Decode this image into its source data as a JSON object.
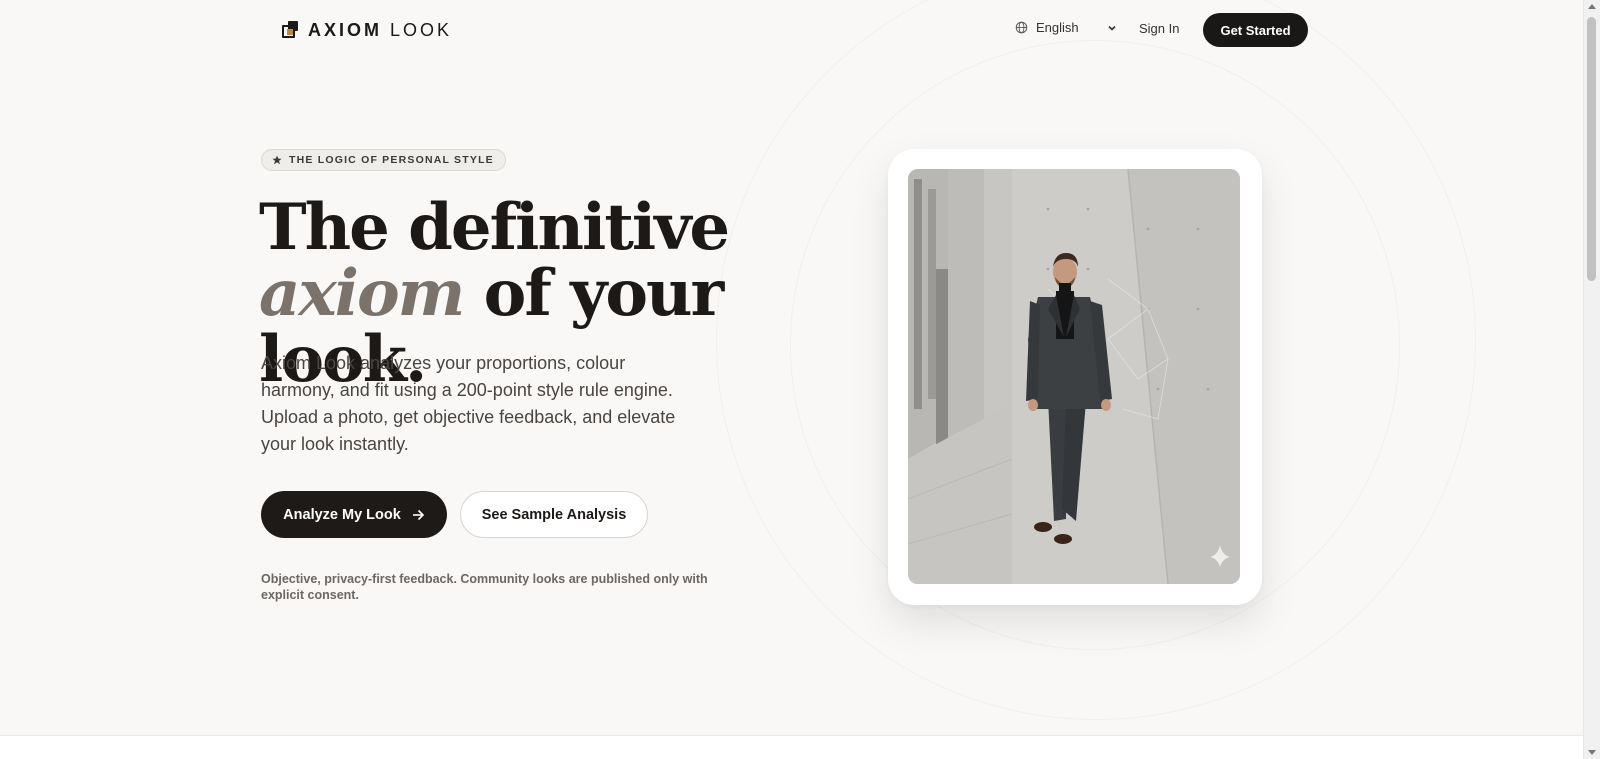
{
  "header": {
    "logo_bold": "AXIOM",
    "logo_light": "LOOK",
    "language": "English",
    "signin_label": "Sign In",
    "get_started_label": "Get Started"
  },
  "hero": {
    "badge": "THE LOGIC OF PERSONAL STYLE",
    "headline_line1": "The definitive",
    "headline_line2_italic": "axiom",
    "headline_line2_rest": "of your look.",
    "subtext": "Axiom Look analyzes your proportions, colour harmony, and fit using a 200-point style rule engine. Upload a photo, get objective feedback, and elevate your look instantly.",
    "primary_cta": "Analyze My Look",
    "secondary_cta": "See Sample Analysis",
    "disclaimer": "Objective, privacy-first feedback. Community looks are published only with explicit consent."
  },
  "image": {
    "description_icon": "sparkle-icon"
  },
  "colors": {
    "background": "#f9f8f6",
    "primary_button": "#1e1a17",
    "italic_accent": "#7b736b",
    "logo_accent": "#b48a4a"
  }
}
